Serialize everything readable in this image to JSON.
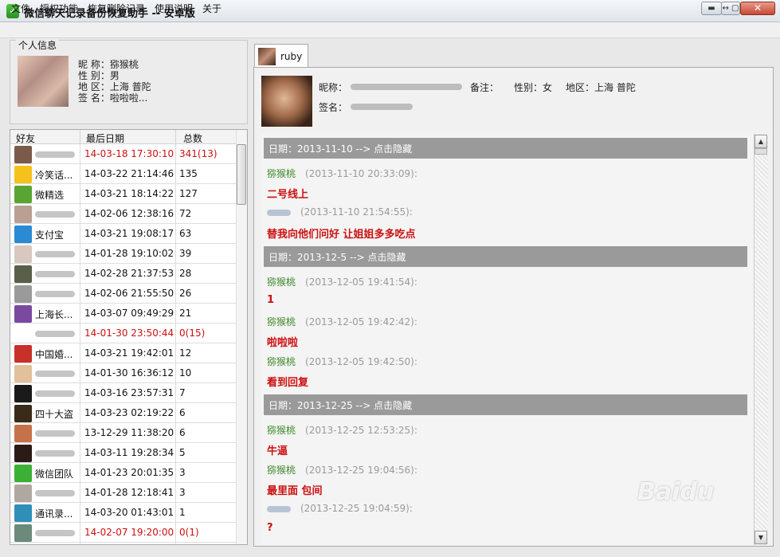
{
  "window": {
    "title": "微信聊天记录备份恢复助手 -- 安卓版",
    "minimize_glyph": "▬",
    "restore_glyph": "↔ ▢",
    "close_glyph": "✕"
  },
  "menu": [
    "文件",
    "授权功能",
    "恢复删除记录",
    "使用说明",
    "关于"
  ],
  "profile": {
    "legend": "个人信息",
    "nickname": "昵  称：猕猴桃",
    "gender": "性  别：男",
    "region": "地  区：上海 普陀",
    "signature": "签  名：啦啦啦..."
  },
  "friends_table": {
    "columns": [
      "好友",
      "最后日期",
      "总数"
    ],
    "rows": [
      {
        "name": "",
        "date": "14-03-18 17:30:10",
        "total": "341(13)",
        "highlight": true,
        "avatar_color": "#7a5b4a"
      },
      {
        "name": "冷笑话...",
        "date": "14-03-22 21:14:46",
        "total": "135",
        "highlight": false,
        "avatar_color": "#f5c21b"
      },
      {
        "name": "微精选",
        "date": "14-03-21 18:14:22",
        "total": "127",
        "highlight": false,
        "avatar_color": "#5aa531"
      },
      {
        "name": "",
        "date": "14-02-06 12:38:16",
        "total": "72",
        "highlight": false,
        "avatar_color": "#b9a092"
      },
      {
        "name": "支付宝",
        "date": "14-03-21 19:08:17",
        "total": "63",
        "highlight": false,
        "avatar_color": "#2a8ad4"
      },
      {
        "name": "",
        "date": "14-01-28 19:10:02",
        "total": "39",
        "highlight": false,
        "avatar_color": "#d8c8c0"
      },
      {
        "name": "",
        "date": "14-02-28 21:37:53",
        "total": "28",
        "highlight": false,
        "avatar_color": "#5a5f4a"
      },
      {
        "name": "",
        "date": "14-02-06 21:55:50",
        "total": "26",
        "highlight": false,
        "avatar_color": "#9a9a9a"
      },
      {
        "name": "上海长...",
        "date": "14-03-07 09:49:29",
        "total": "21",
        "highlight": false,
        "avatar_color": "#7a4aa0"
      },
      {
        "name": "",
        "date": "14-01-30 23:50:44",
        "total": "0(15)",
        "highlight": true,
        "avatar_color": "#ffffff"
      },
      {
        "name": "中国婚...",
        "date": "14-03-21 19:42:01",
        "total": "12",
        "highlight": false,
        "avatar_color": "#c8302a"
      },
      {
        "name": "",
        "date": "14-01-30 16:36:12",
        "total": "10",
        "highlight": false,
        "avatar_color": "#e2c09a"
      },
      {
        "name": "",
        "date": "14-03-16 23:57:31",
        "total": "7",
        "highlight": false,
        "avatar_color": "#1a1a1a"
      },
      {
        "name": "四十大盗",
        "date": "14-03-23 02:19:22",
        "total": "6",
        "highlight": false,
        "avatar_color": "#3a2a1a"
      },
      {
        "name": "",
        "date": "13-12-29 11:38:20",
        "total": "6",
        "highlight": false,
        "avatar_color": "#c7714a"
      },
      {
        "name": "",
        "date": "14-03-11 19:28:34",
        "total": "5",
        "highlight": false,
        "avatar_color": "#2a1a18"
      },
      {
        "name": "微信团队",
        "date": "14-01-23 20:01:35",
        "total": "3",
        "highlight": false,
        "avatar_color": "#3cb034"
      },
      {
        "name": "",
        "date": "14-01-28 12:18:41",
        "total": "3",
        "highlight": false,
        "avatar_color": "#b0a8a0"
      },
      {
        "name": "通讯录...",
        "date": "14-03-20 01:43:01",
        "total": "1",
        "highlight": false,
        "avatar_color": "#2f8fb8"
      },
      {
        "name": "",
        "date": "14-02-07 19:20:00",
        "total": "0(1)",
        "highlight": true,
        "avatar_color": "#6b8a7a"
      }
    ]
  },
  "tab": {
    "label": "ruby"
  },
  "contact": {
    "nickname_label": "昵称：",
    "note_label": "备注：",
    "gender": "性别：女",
    "region": "地区：上海 普陀",
    "signature_label": "签名："
  },
  "chat": {
    "sections": [
      {
        "header": "日期：2013-11-10  --> 点击隐藏",
        "messages": [
          {
            "sender": "猕猴桃",
            "time": "(2013-11-10 20:33:09):",
            "text": "二号线上",
            "blurred": false
          },
          {
            "sender": "",
            "time": "(2013-11-10 21:54:55):",
            "text": "替我向他们问好 让姐姐多多吃点",
            "blurred": true
          }
        ]
      },
      {
        "header": "日期：2013-12-5  --> 点击隐藏",
        "messages": [
          {
            "sender": "猕猴桃",
            "time": "(2013-12-05 19:41:54):",
            "text": "1",
            "blurred": false
          },
          {
            "sender": "猕猴桃",
            "time": "(2013-12-05 19:42:42):",
            "text": "啦啦啦",
            "blurred": false
          },
          {
            "sender": "猕猴桃",
            "time": "(2013-12-05 19:42:50):",
            "text": "看到回复",
            "blurred": false
          }
        ]
      },
      {
        "header": "日期：2013-12-25  --> 点击隐藏",
        "messages": [
          {
            "sender": "猕猴桃",
            "time": "(2013-12-25 12:53:25):",
            "text": "牛逼",
            "blurred": false
          },
          {
            "sender": "猕猴桃",
            "time": "(2013-12-25 19:04:56):",
            "text": "最里面 包间",
            "blurred": false
          },
          {
            "sender": "",
            "time": "(2013-12-25 19:04:59):",
            "text": "?",
            "blurred": true
          }
        ]
      }
    ]
  },
  "watermark": "Baidu",
  "colors": {
    "highlight_red": "#cc1010",
    "sender_green": "#3f8a2b",
    "date_bar": "#9a9a9a"
  },
  "icons": [
    "app-shield-icon",
    "scroll-up-icon",
    "scroll-down-icon"
  ]
}
